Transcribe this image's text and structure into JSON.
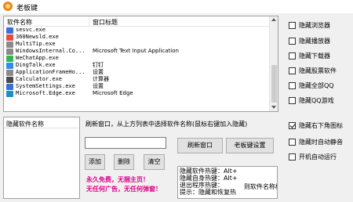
{
  "window": {
    "title": "老板键"
  },
  "process_list": {
    "headers": [
      "软件名称",
      "窗口标题"
    ],
    "rows": [
      {
        "name": "sesvc.exe",
        "title": "",
        "icon": "blue-square-icon",
        "color": "#3a6fd8"
      },
      {
        "name": "360Newsld.exe",
        "title": "",
        "icon": "360-icon",
        "color": "#e74c3c"
      },
      {
        "name": "MultiTip.exe",
        "title": "",
        "icon": "window-icon",
        "color": "#8a8a8a"
      },
      {
        "name": "WindowsInternal.Co...",
        "title": "Microsoft Text Input Application",
        "icon": "window-icon",
        "color": "#8a8a8a"
      },
      {
        "name": "WeChatApp.exe",
        "title": "",
        "icon": "wechat-icon",
        "color": "#2fb84f"
      },
      {
        "name": "DingTalk.exe",
        "title": "钉钉",
        "icon": "dingtalk-icon",
        "color": "#2f8cf0"
      },
      {
        "name": "ApplicationFrameHo...",
        "title": "设置",
        "icon": "window-icon",
        "color": "#8a8a8a"
      },
      {
        "name": "Calculator.exe",
        "title": "计算器",
        "icon": "calculator-icon",
        "color": "#4a4a4a"
      },
      {
        "name": "SystemSettings.exe",
        "title": "设置",
        "icon": "gear-icon",
        "color": "#3a6fd8"
      },
      {
        "name": "Microsoft.Edge.exe",
        "title": "Microsoft Edge",
        "icon": "edge-icon",
        "color": "#1e90c8"
      }
    ]
  },
  "options": [
    {
      "label": "隐藏浏览器",
      "checked": false
    },
    {
      "label": "隐藏播放器",
      "checked": false
    },
    {
      "label": "隐藏下载器",
      "checked": false
    },
    {
      "label": "隐藏股票软件",
      "checked": false
    },
    {
      "label": "隐藏全部QQ",
      "checked": false
    },
    {
      "label": "隐藏QQ游戏",
      "checked": false
    },
    {
      "label": "隐藏右下角图标",
      "checked": true
    },
    {
      "label": "隐藏时自动静音",
      "checked": false
    },
    {
      "label": "开机自动运行",
      "checked": false
    }
  ],
  "hidden_list": {
    "header": "隐藏软件名称"
  },
  "instruction": "刷新窗口，从上方列表中选择软件名称(鼠标右键加入隐藏)",
  "input": {
    "value": ""
  },
  "buttons": {
    "add": "添加",
    "delete": "删除",
    "clear": "清空",
    "refresh": "刷新窗口",
    "settings": "老板键设置"
  },
  "promo": {
    "line1": "永久免费，无捆主页！",
    "line2": "无任何广告，无任何弹窗！"
  },
  "hotkeys": {
    "line1": "隐藏软件热键：Alt+",
    "line2": "隐藏自身热键：Alt+",
    "line3": "退出程序热键：",
    "line4": "提示：隐藏和恢复热",
    "tip": "则软件名称标"
  }
}
